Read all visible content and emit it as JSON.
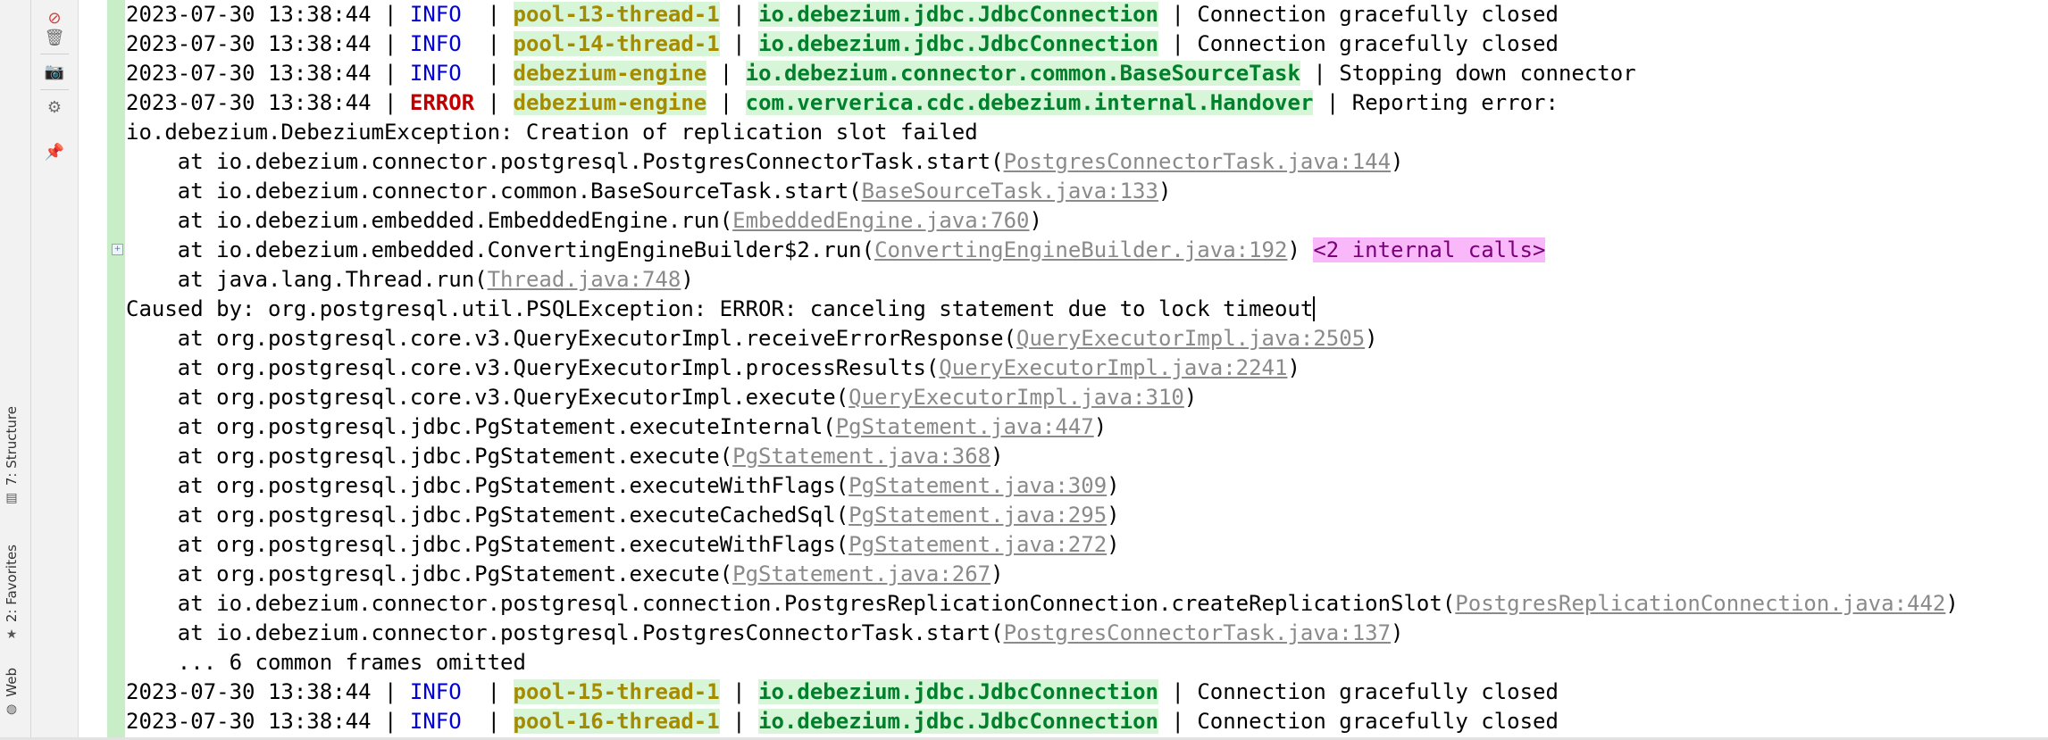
{
  "side_tabs": [
    {
      "label": "7: Structure",
      "icon": "structure-icon"
    },
    {
      "label": "2: Favorites",
      "icon": "star-icon"
    },
    {
      "label": "Web",
      "icon": "globe-icon"
    }
  ],
  "toolbar_icons": [
    "soft-wrap-off-icon",
    "print-icon",
    "trash-icon",
    "camera-icon",
    "settings-icon",
    "pin-icon"
  ],
  "colors": {
    "info": "#0000d6",
    "error": "#c00000",
    "thread": "#a58b00",
    "logger": "#00802b",
    "highlight": "#d7f5d7",
    "link": "#8a8a8a",
    "internal_calls": "#f9b8f9"
  },
  "console": {
    "header_logs": [
      {
        "timestamp": "2023-07-30 13:38:44",
        "level": "INFO ",
        "thread": "pool-13-thread-1",
        "logger": "io.debezium.jdbc.JdbcConnection",
        "message": "Connection gracefully closed"
      },
      {
        "timestamp": "2023-07-30 13:38:44",
        "level": "INFO ",
        "thread": "pool-14-thread-1",
        "logger": "io.debezium.jdbc.JdbcConnection",
        "message": "Connection gracefully closed"
      },
      {
        "timestamp": "2023-07-30 13:38:44",
        "level": "INFO ",
        "thread": "debezium-engine",
        "logger": "io.debezium.connector.common.BaseSourceTask",
        "message": "Stopping down connector"
      },
      {
        "timestamp": "2023-07-30 13:38:44",
        "level": "ERROR",
        "thread": "debezium-engine",
        "logger": "com.ververica.cdc.debezium.internal.Handover",
        "message": "Reporting error:"
      }
    ],
    "exception": "io.debezium.DebeziumException: Creation of replication slot failed",
    "stack1": [
      {
        "method": "io.debezium.connector.postgresql.PostgresConnectorTask.start",
        "source": "PostgresConnectorTask.java:144"
      },
      {
        "method": "io.debezium.connector.common.BaseSourceTask.start",
        "source": "BaseSourceTask.java:133"
      },
      {
        "method": "io.debezium.embedded.EmbeddedEngine.run",
        "source": "EmbeddedEngine.java:760"
      },
      {
        "method": "io.debezium.embedded.ConvertingEngineBuilder$2.run",
        "source": "ConvertingEngineBuilder.java:192",
        "internal": "<2 internal calls>"
      },
      {
        "method": "java.lang.Thread.run",
        "source": "Thread.java:748"
      }
    ],
    "caused_by": "Caused by: org.postgresql.util.PSQLException: ERROR: canceling statement due to lock timeout",
    "stack2": [
      {
        "method": "org.postgresql.core.v3.QueryExecutorImpl.receiveErrorResponse",
        "source": "QueryExecutorImpl.java:2505"
      },
      {
        "method": "org.postgresql.core.v3.QueryExecutorImpl.processResults",
        "source": "QueryExecutorImpl.java:2241"
      },
      {
        "method": "org.postgresql.core.v3.QueryExecutorImpl.execute",
        "source": "QueryExecutorImpl.java:310"
      },
      {
        "method": "org.postgresql.jdbc.PgStatement.executeInternal",
        "source": "PgStatement.java:447"
      },
      {
        "method": "org.postgresql.jdbc.PgStatement.execute",
        "source": "PgStatement.java:368"
      },
      {
        "method": "org.postgresql.jdbc.PgStatement.executeWithFlags",
        "source": "PgStatement.java:309"
      },
      {
        "method": "org.postgresql.jdbc.PgStatement.executeCachedSql",
        "source": "PgStatement.java:295"
      },
      {
        "method": "org.postgresql.jdbc.PgStatement.executeWithFlags",
        "source": "PgStatement.java:272"
      },
      {
        "method": "org.postgresql.jdbc.PgStatement.execute",
        "source": "PgStatement.java:267"
      },
      {
        "method": "io.debezium.connector.postgresql.connection.PostgresReplicationConnection.createReplicationSlot",
        "source": "PostgresReplicationConnection.java:442"
      },
      {
        "method": "io.debezium.connector.postgresql.PostgresConnectorTask.start",
        "source": "PostgresConnectorTask.java:137"
      }
    ],
    "omitted": "    ... 6 common frames omitted",
    "footer_logs": [
      {
        "timestamp": "2023-07-30 13:38:44",
        "level": "INFO ",
        "thread": "pool-15-thread-1",
        "logger": "io.debezium.jdbc.JdbcConnection",
        "message": "Connection gracefully closed"
      },
      {
        "timestamp": "2023-07-30 13:38:44",
        "level": "INFO ",
        "thread": "pool-16-thread-1",
        "logger": "io.debezium.jdbc.JdbcConnection",
        "message": "Connection gracefully closed"
      }
    ]
  }
}
